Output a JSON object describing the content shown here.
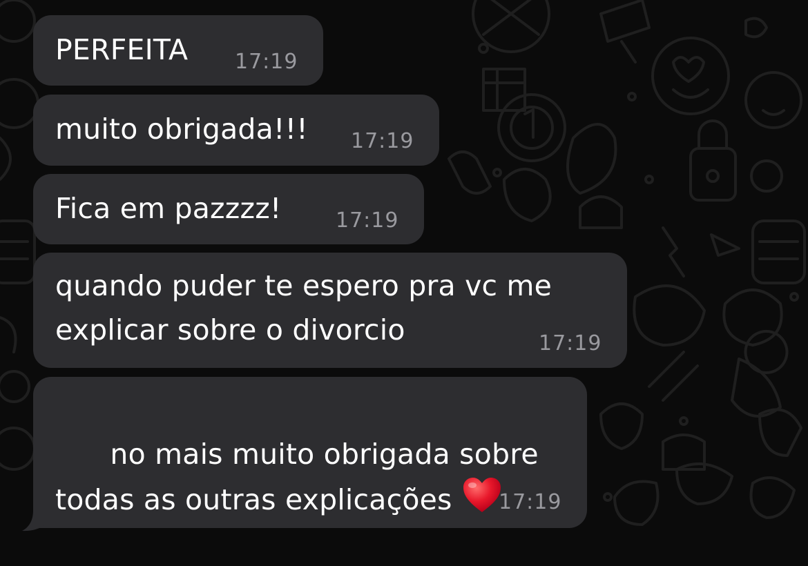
{
  "messages": [
    {
      "text": "PERFEITA",
      "time": "17:19"
    },
    {
      "text": "muito obrigada!!!",
      "time": "17:19"
    },
    {
      "text": "Fica em pazzzz!",
      "time": "17:19"
    },
    {
      "text": "quando puder te espero pra vc me explicar sobre o divorcio",
      "time": "17:19"
    },
    {
      "text": "no mais muito obrigada sobre todas as outras explicações",
      "emoji": "red-heart",
      "time": "17:19"
    }
  ],
  "colors": {
    "bubble": "#2d2d30",
    "text": "#ffffff",
    "timestamp": "#9a9a9f",
    "background": "#0b0b0b",
    "heart": "#e8182b"
  }
}
